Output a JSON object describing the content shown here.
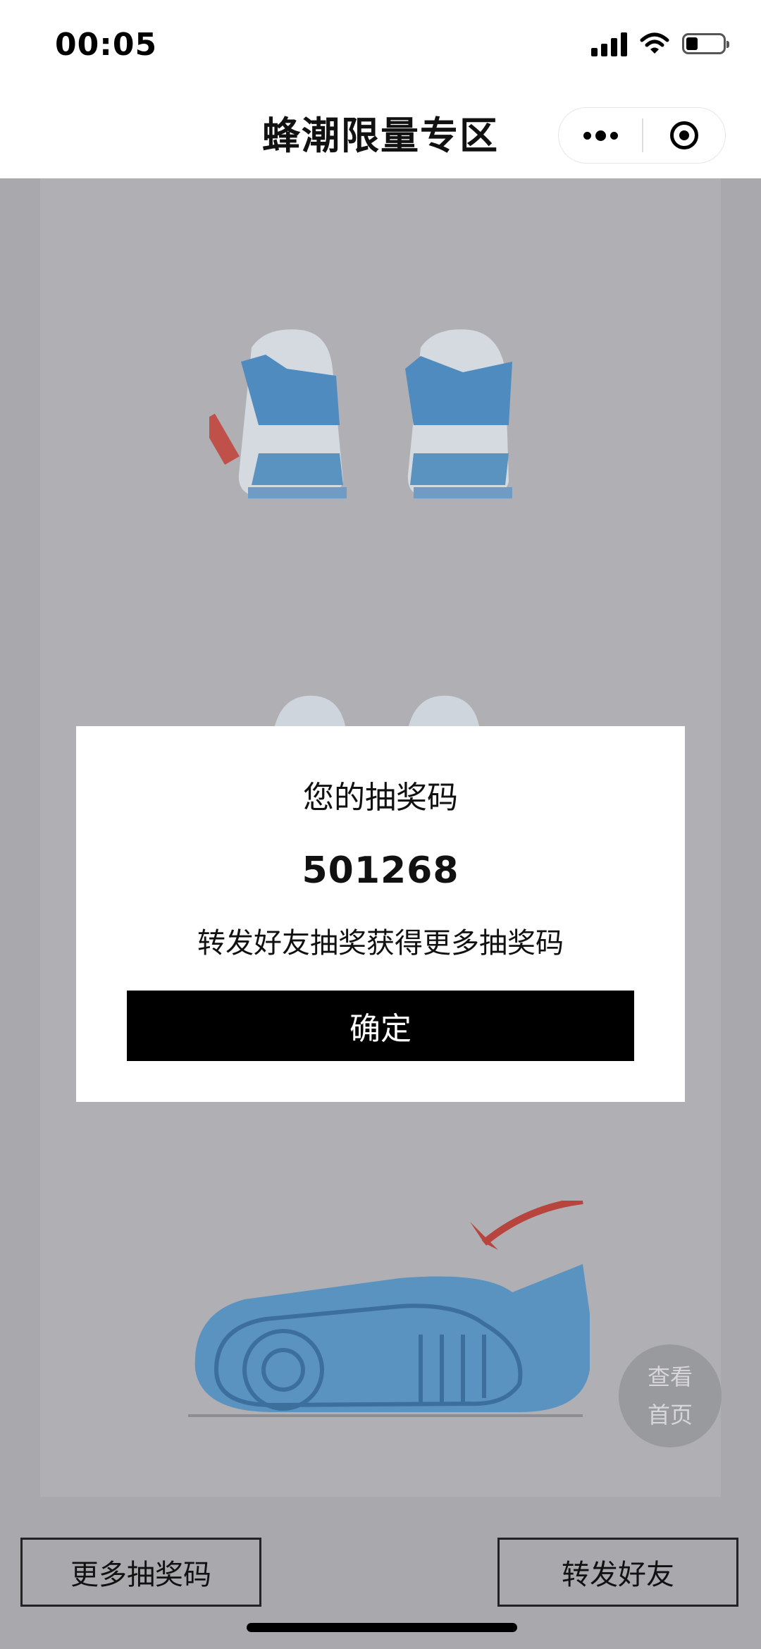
{
  "status_bar": {
    "time": "00:05",
    "icons": [
      "signal-icon",
      "wifi-icon",
      "battery-icon"
    ]
  },
  "nav": {
    "title": "蜂潮限量专区",
    "more_icon": "more-dots-icon",
    "close_icon": "target-close-icon"
  },
  "dialog": {
    "title": "您的抽奖码",
    "code": "501268",
    "hint": "转发好友抽奖获得更多抽奖码",
    "confirm_label": "确定"
  },
  "floating_home": {
    "line1": "查看",
    "line2": "首页"
  },
  "bottom_bar": {
    "more_codes_label": "更多抽奖码",
    "share_label": "转发好友"
  },
  "colors": {
    "overlay": "#a9a9ad",
    "dialog_bg": "#ffffff",
    "confirm_bg": "#000000",
    "shoe_blue": "#5b93c0"
  }
}
